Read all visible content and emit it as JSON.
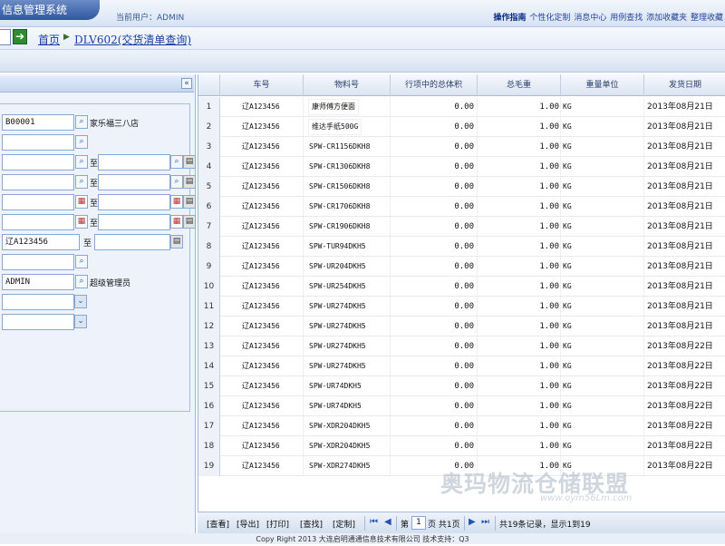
{
  "header": {
    "app_title": "信息管理系统",
    "current_user": "当前用户：ADMIN",
    "links": [
      "操作指南",
      "个性化定制",
      "消息中心",
      "用例查找",
      "添加收藏夹",
      "整理收藏"
    ]
  },
  "breadcrumb": {
    "home": "首页",
    "page": "DLV602(交货清单查询)",
    "go_icon": "arrow-right-icon"
  },
  "left_panel": {
    "collapse_icon": "double-chevron-left-icon",
    "fields": [
      {
        "value": "B00001",
        "lookup_text": "家乐福三八店"
      },
      {
        "value": ""
      },
      {
        "value": "",
        "range_sep": "至",
        "to_value": ""
      },
      {
        "value": "",
        "range_sep": "至",
        "to_value": ""
      },
      {
        "value": "",
        "range_sep": "至",
        "to_value": ""
      },
      {
        "value": "",
        "range_sep": "至",
        "to_value": ""
      },
      {
        "value": "辽A123456",
        "range_sep": "至",
        "to_value": ""
      },
      {
        "value": ""
      },
      {
        "value": "ADMIN",
        "lookup_text": "超级管理员"
      },
      {
        "value": ""
      },
      {
        "value": ""
      }
    ]
  },
  "grid": {
    "columns": [
      "车号",
      "物料号",
      "行项中的总体积",
      "总毛重",
      "重量单位",
      "发货日期"
    ],
    "rows": [
      {
        "n": "1",
        "plate": "辽A123456",
        "mat": "康师傅方便面",
        "vol": "0.00",
        "gross": "1.00",
        "unit": "KG",
        "date": "2013年08月21日"
      },
      {
        "n": "2",
        "plate": "辽A123456",
        "mat": "维达手纸500G",
        "vol": "0.00",
        "gross": "1.00",
        "unit": "KG",
        "date": "2013年08月21日"
      },
      {
        "n": "3",
        "plate": "辽A123456",
        "mat": "SPW-CR1156DKH8",
        "vol": "0.00",
        "gross": "1.00",
        "unit": "KG",
        "date": "2013年08月21日"
      },
      {
        "n": "4",
        "plate": "辽A123456",
        "mat": "SPW-CR1306DKH8",
        "vol": "0.00",
        "gross": "1.00",
        "unit": "KG",
        "date": "2013年08月21日"
      },
      {
        "n": "5",
        "plate": "辽A123456",
        "mat": "SPW-CR1506DKH8",
        "vol": "0.00",
        "gross": "1.00",
        "unit": "KG",
        "date": "2013年08月21日"
      },
      {
        "n": "6",
        "plate": "辽A123456",
        "mat": "SPW-CR1706DKH8",
        "vol": "0.00",
        "gross": "1.00",
        "unit": "KG",
        "date": "2013年08月21日"
      },
      {
        "n": "7",
        "plate": "辽A123456",
        "mat": "SPW-CR1906DKH8",
        "vol": "0.00",
        "gross": "1.00",
        "unit": "KG",
        "date": "2013年08月21日"
      },
      {
        "n": "8",
        "plate": "辽A123456",
        "mat": "SPW-TUR94DKH5",
        "vol": "0.00",
        "gross": "1.00",
        "unit": "KG",
        "date": "2013年08月21日"
      },
      {
        "n": "9",
        "plate": "辽A123456",
        "mat": "SPW-UR204DKH5",
        "vol": "0.00",
        "gross": "1.00",
        "unit": "KG",
        "date": "2013年08月21日"
      },
      {
        "n": "10",
        "plate": "辽A123456",
        "mat": "SPW-UR254DKH5",
        "vol": "0.00",
        "gross": "1.00",
        "unit": "KG",
        "date": "2013年08月21日"
      },
      {
        "n": "11",
        "plate": "辽A123456",
        "mat": "SPW-UR274DKH5",
        "vol": "0.00",
        "gross": "1.00",
        "unit": "KG",
        "date": "2013年08月21日"
      },
      {
        "n": "12",
        "plate": "辽A123456",
        "mat": "SPW-UR274DKH5",
        "vol": "0.00",
        "gross": "1.00",
        "unit": "KG",
        "date": "2013年08月21日"
      },
      {
        "n": "13",
        "plate": "辽A123456",
        "mat": "SPW-UR274DKH5",
        "vol": "0.00",
        "gross": "1.00",
        "unit": "KG",
        "date": "2013年08月22日"
      },
      {
        "n": "14",
        "plate": "辽A123456",
        "mat": "SPW-UR274DKH5",
        "vol": "0.00",
        "gross": "1.00",
        "unit": "KG",
        "date": "2013年08月22日"
      },
      {
        "n": "15",
        "plate": "辽A123456",
        "mat": "SPW-UR74DKH5",
        "vol": "0.00",
        "gross": "1.00",
        "unit": "KG",
        "date": "2013年08月22日"
      },
      {
        "n": "16",
        "plate": "辽A123456",
        "mat": "SPW-UR74DKH5",
        "vol": "0.00",
        "gross": "1.00",
        "unit": "KG",
        "date": "2013年08月22日"
      },
      {
        "n": "17",
        "plate": "辽A123456",
        "mat": "SPW-XDR204DKH5",
        "vol": "0.00",
        "gross": "1.00",
        "unit": "KG",
        "date": "2013年08月22日"
      },
      {
        "n": "18",
        "plate": "辽A123456",
        "mat": "SPW-XDR204DKH5",
        "vol": "0.00",
        "gross": "1.00",
        "unit": "KG",
        "date": "2013年08月22日"
      },
      {
        "n": "19",
        "plate": "辽A123456",
        "mat": "SPW-XDR274DKH5",
        "vol": "0.00",
        "gross": "1.00",
        "unit": "KG",
        "date": "2013年08月22日"
      }
    ]
  },
  "pager": {
    "buttons": [
      "[查看]",
      "[导出]",
      "[打印]",
      "[查找]",
      "[定制]"
    ],
    "page_prefix": "第",
    "page_value": "1",
    "page_suffix": "页 共1页",
    "summary": "共19条记录，显示1到19",
    "nav_icons": [
      "first-page-icon",
      "prev-page-icon",
      "next-page-icon",
      "last-page-icon"
    ]
  },
  "footer": {
    "copyright": "Copy Right 2013 大连启明通通信息技术有限公司 技术支持：Q3"
  },
  "watermark": {
    "main": "奥玛物流仓储联盟",
    "sub": "www.oym56Lm.com"
  }
}
